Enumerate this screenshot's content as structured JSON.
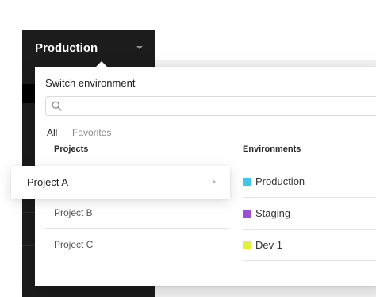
{
  "sidebar": {
    "current_environment": "Production",
    "caret_icon": "chevron-down-icon"
  },
  "switcher": {
    "title": "Switch environment",
    "search": {
      "value": "",
      "placeholder": "",
      "icon": "search-icon"
    },
    "tabs": [
      {
        "label": "All",
        "active": true
      },
      {
        "label": "Favorites",
        "active": false
      }
    ],
    "projects_header": "Projects",
    "environments_header": "Environments",
    "projects": [
      {
        "label": "Project A",
        "highlighted": true,
        "icon": "chevron-right-icon"
      },
      {
        "label": "Project B",
        "highlighted": false
      },
      {
        "label": "Project C",
        "highlighted": false
      }
    ],
    "environments": [
      {
        "label": "Production",
        "color": "#3fc6e8"
      },
      {
        "label": "Staging",
        "color": "#9b4fd6"
      },
      {
        "label": "Dev 1",
        "color": "#e2ef3b"
      }
    ]
  }
}
